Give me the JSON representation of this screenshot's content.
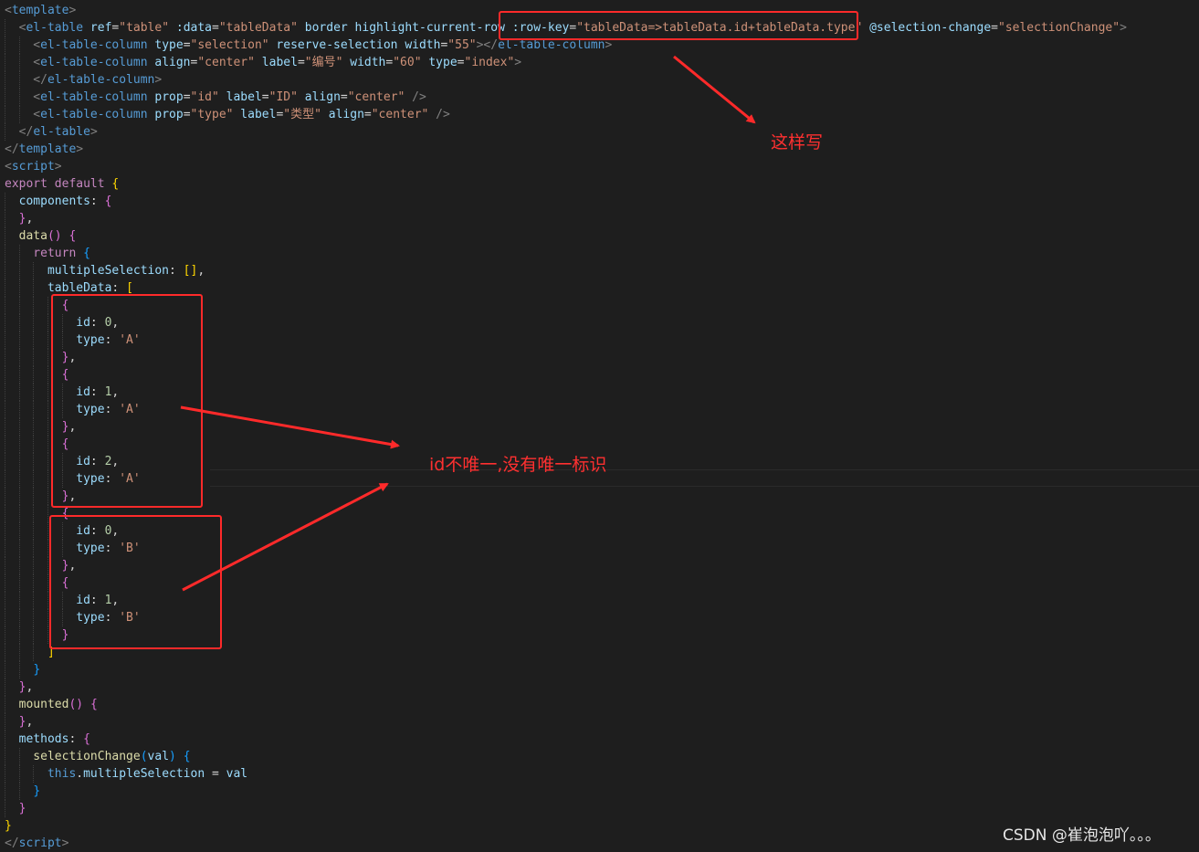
{
  "editor": {
    "lines": [
      {
        "tokens": [
          {
            "t": "<",
            "c": "t-ptag"
          },
          {
            "t": "template",
            "c": "t-tag"
          },
          {
            "t": ">",
            "c": "t-ptag"
          }
        ]
      },
      {
        "tokens": [
          {
            "t": "  <",
            "c": "t-ptag"
          },
          {
            "t": "el-table",
            "c": "t-tag"
          },
          {
            "t": " ref",
            "c": "t-attr"
          },
          {
            "t": "=",
            "c": "t-punc"
          },
          {
            "t": "\"table\"",
            "c": "t-str"
          },
          {
            "t": " :data",
            "c": "t-attr"
          },
          {
            "t": "=",
            "c": "t-punc"
          },
          {
            "t": "\"tableData\"",
            "c": "t-str"
          },
          {
            "t": " border",
            "c": "t-attr"
          },
          {
            "t": " highlight-current-row",
            "c": "t-attr"
          },
          {
            "t": " :row-key",
            "c": "t-attr"
          },
          {
            "t": "=",
            "c": "t-punc"
          },
          {
            "t": "\"tableData=>tableData.id+tableData.type\"",
            "c": "t-str"
          },
          {
            "t": " @selection-change",
            "c": "t-attr"
          },
          {
            "t": "=",
            "c": "t-punc"
          },
          {
            "t": "\"selectionChange\"",
            "c": "t-str"
          },
          {
            "t": ">",
            "c": "t-ptag"
          }
        ]
      },
      {
        "tokens": [
          {
            "t": "    <",
            "c": "t-ptag"
          },
          {
            "t": "el-table-column",
            "c": "t-tag"
          },
          {
            "t": " type",
            "c": "t-attr"
          },
          {
            "t": "=",
            "c": "t-punc"
          },
          {
            "t": "\"selection\"",
            "c": "t-str"
          },
          {
            "t": " reserve-selection",
            "c": "t-attr"
          },
          {
            "t": " width",
            "c": "t-attr"
          },
          {
            "t": "=",
            "c": "t-punc"
          },
          {
            "t": "\"55\"",
            "c": "t-str"
          },
          {
            "t": "></",
            "c": "t-ptag"
          },
          {
            "t": "el-table-column",
            "c": "t-tag"
          },
          {
            "t": ">",
            "c": "t-ptag"
          }
        ]
      },
      {
        "tokens": [
          {
            "t": "    <",
            "c": "t-ptag"
          },
          {
            "t": "el-table-column",
            "c": "t-tag"
          },
          {
            "t": " align",
            "c": "t-attr"
          },
          {
            "t": "=",
            "c": "t-punc"
          },
          {
            "t": "\"center\"",
            "c": "t-str"
          },
          {
            "t": " label",
            "c": "t-attr"
          },
          {
            "t": "=",
            "c": "t-punc"
          },
          {
            "t": "\"编号\"",
            "c": "t-str"
          },
          {
            "t": " width",
            "c": "t-attr"
          },
          {
            "t": "=",
            "c": "t-punc"
          },
          {
            "t": "\"60\"",
            "c": "t-str"
          },
          {
            "t": " type",
            "c": "t-attr"
          },
          {
            "t": "=",
            "c": "t-punc"
          },
          {
            "t": "\"index\"",
            "c": "t-str"
          },
          {
            "t": ">",
            "c": "t-ptag"
          }
        ]
      },
      {
        "tokens": [
          {
            "t": "    </",
            "c": "t-ptag"
          },
          {
            "t": "el-table-column",
            "c": "t-tag"
          },
          {
            "t": ">",
            "c": "t-ptag"
          }
        ]
      },
      {
        "tokens": [
          {
            "t": "    <",
            "c": "t-ptag"
          },
          {
            "t": "el-table-column",
            "c": "t-tag"
          },
          {
            "t": " prop",
            "c": "t-attr"
          },
          {
            "t": "=",
            "c": "t-punc"
          },
          {
            "t": "\"id\"",
            "c": "t-str"
          },
          {
            "t": " label",
            "c": "t-attr"
          },
          {
            "t": "=",
            "c": "t-punc"
          },
          {
            "t": "\"ID\"",
            "c": "t-str"
          },
          {
            "t": " align",
            "c": "t-attr"
          },
          {
            "t": "=",
            "c": "t-punc"
          },
          {
            "t": "\"center\"",
            "c": "t-str"
          },
          {
            "t": " />",
            "c": "t-ptag"
          }
        ]
      },
      {
        "tokens": [
          {
            "t": "    <",
            "c": "t-ptag"
          },
          {
            "t": "el-table-column",
            "c": "t-tag"
          },
          {
            "t": " prop",
            "c": "t-attr"
          },
          {
            "t": "=",
            "c": "t-punc"
          },
          {
            "t": "\"type\"",
            "c": "t-str"
          },
          {
            "t": " label",
            "c": "t-attr"
          },
          {
            "t": "=",
            "c": "t-punc"
          },
          {
            "t": "\"类型\"",
            "c": "t-str"
          },
          {
            "t": " align",
            "c": "t-attr"
          },
          {
            "t": "=",
            "c": "t-punc"
          },
          {
            "t": "\"center\"",
            "c": "t-str"
          },
          {
            "t": " />",
            "c": "t-ptag"
          }
        ]
      },
      {
        "tokens": [
          {
            "t": "  </",
            "c": "t-ptag"
          },
          {
            "t": "el-table",
            "c": "t-tag"
          },
          {
            "t": ">",
            "c": "t-ptag"
          }
        ]
      },
      {
        "tokens": [
          {
            "t": "</",
            "c": "t-ptag"
          },
          {
            "t": "template",
            "c": "t-tag"
          },
          {
            "t": ">",
            "c": "t-ptag"
          }
        ]
      },
      {
        "tokens": [
          {
            "t": "<",
            "c": "t-ptag"
          },
          {
            "t": "script",
            "c": "t-tag"
          },
          {
            "t": ">",
            "c": "t-ptag"
          }
        ]
      },
      {
        "tokens": [
          {
            "t": "export",
            "c": "t-kw"
          },
          {
            "t": " default ",
            "c": "t-kw"
          },
          {
            "t": "{",
            "c": "t-b1"
          }
        ]
      },
      {
        "tokens": [
          {
            "t": "  components",
            "c": "t-prop"
          },
          {
            "t": ": ",
            "c": "t-punc"
          },
          {
            "t": "{",
            "c": "t-b2"
          }
        ]
      },
      {
        "tokens": [
          {
            "t": "  ",
            "c": "t-def"
          },
          {
            "t": "}",
            "c": "t-b2"
          },
          {
            "t": ",",
            "c": "t-punc"
          }
        ]
      },
      {
        "tokens": [
          {
            "t": "  data",
            "c": "t-func"
          },
          {
            "t": "()",
            "c": "t-b2"
          },
          {
            "t": " ",
            "c": "t-def"
          },
          {
            "t": "{",
            "c": "t-b2"
          }
        ]
      },
      {
        "tokens": [
          {
            "t": "    return",
            "c": "t-kw"
          },
          {
            "t": " ",
            "c": "t-def"
          },
          {
            "t": "{",
            "c": "t-b3"
          }
        ]
      },
      {
        "tokens": [
          {
            "t": "      multipleSelection",
            "c": "t-prop"
          },
          {
            "t": ": ",
            "c": "t-punc"
          },
          {
            "t": "[]",
            "c": "t-b1"
          },
          {
            "t": ",",
            "c": "t-punc"
          }
        ]
      },
      {
        "tokens": [
          {
            "t": "      tableData",
            "c": "t-prop"
          },
          {
            "t": ": ",
            "c": "t-punc"
          },
          {
            "t": "[",
            "c": "t-b1"
          }
        ]
      },
      {
        "tokens": [
          {
            "t": "        ",
            "c": "t-def"
          },
          {
            "t": "{",
            "c": "t-b2"
          }
        ]
      },
      {
        "tokens": [
          {
            "t": "          id",
            "c": "t-prop"
          },
          {
            "t": ": ",
            "c": "t-punc"
          },
          {
            "t": "0",
            "c": "t-num"
          },
          {
            "t": ",",
            "c": "t-punc"
          }
        ]
      },
      {
        "tokens": [
          {
            "t": "          type",
            "c": "t-prop"
          },
          {
            "t": ": ",
            "c": "t-punc"
          },
          {
            "t": "'A'",
            "c": "t-str"
          }
        ]
      },
      {
        "tokens": [
          {
            "t": "        ",
            "c": "t-def"
          },
          {
            "t": "}",
            "c": "t-b2"
          },
          {
            "t": ",",
            "c": "t-punc"
          }
        ]
      },
      {
        "tokens": [
          {
            "t": "        ",
            "c": "t-def"
          },
          {
            "t": "{",
            "c": "t-b2"
          }
        ]
      },
      {
        "tokens": [
          {
            "t": "          id",
            "c": "t-prop"
          },
          {
            "t": ": ",
            "c": "t-punc"
          },
          {
            "t": "1",
            "c": "t-num"
          },
          {
            "t": ",",
            "c": "t-punc"
          }
        ]
      },
      {
        "tokens": [
          {
            "t": "          type",
            "c": "t-prop"
          },
          {
            "t": ": ",
            "c": "t-punc"
          },
          {
            "t": "'A'",
            "c": "t-str"
          }
        ]
      },
      {
        "tokens": [
          {
            "t": "        ",
            "c": "t-def"
          },
          {
            "t": "}",
            "c": "t-b2"
          },
          {
            "t": ",",
            "c": "t-punc"
          }
        ]
      },
      {
        "tokens": [
          {
            "t": "        ",
            "c": "t-def"
          },
          {
            "t": "{",
            "c": "t-b2"
          }
        ]
      },
      {
        "tokens": [
          {
            "t": "          id",
            "c": "t-prop"
          },
          {
            "t": ": ",
            "c": "t-punc"
          },
          {
            "t": "2",
            "c": "t-num"
          },
          {
            "t": ",",
            "c": "t-punc"
          }
        ]
      },
      {
        "tokens": [
          {
            "t": "          type",
            "c": "t-prop"
          },
          {
            "t": ": ",
            "c": "t-punc"
          },
          {
            "t": "'A'",
            "c": "t-str"
          }
        ]
      },
      {
        "tokens": [
          {
            "t": "        ",
            "c": "t-def"
          },
          {
            "t": "}",
            "c": "t-b2"
          },
          {
            "t": ",",
            "c": "t-punc"
          }
        ]
      },
      {
        "tokens": [
          {
            "t": "        ",
            "c": "t-def"
          },
          {
            "t": "{",
            "c": "t-b2"
          }
        ]
      },
      {
        "tokens": [
          {
            "t": "          id",
            "c": "t-prop"
          },
          {
            "t": ": ",
            "c": "t-punc"
          },
          {
            "t": "0",
            "c": "t-num"
          },
          {
            "t": ",",
            "c": "t-punc"
          }
        ]
      },
      {
        "tokens": [
          {
            "t": "          type",
            "c": "t-prop"
          },
          {
            "t": ": ",
            "c": "t-punc"
          },
          {
            "t": "'B'",
            "c": "t-str"
          }
        ]
      },
      {
        "tokens": [
          {
            "t": "        ",
            "c": "t-def"
          },
          {
            "t": "}",
            "c": "t-b2"
          },
          {
            "t": ",",
            "c": "t-punc"
          }
        ]
      },
      {
        "tokens": [
          {
            "t": "        ",
            "c": "t-def"
          },
          {
            "t": "{",
            "c": "t-b2"
          }
        ]
      },
      {
        "tokens": [
          {
            "t": "          id",
            "c": "t-prop"
          },
          {
            "t": ": ",
            "c": "t-punc"
          },
          {
            "t": "1",
            "c": "t-num"
          },
          {
            "t": ",",
            "c": "t-punc"
          }
        ]
      },
      {
        "tokens": [
          {
            "t": "          type",
            "c": "t-prop"
          },
          {
            "t": ": ",
            "c": "t-punc"
          },
          {
            "t": "'B'",
            "c": "t-str"
          }
        ]
      },
      {
        "tokens": [
          {
            "t": "        ",
            "c": "t-def"
          },
          {
            "t": "}",
            "c": "t-b2"
          }
        ]
      },
      {
        "tokens": [
          {
            "t": "      ",
            "c": "t-def"
          },
          {
            "t": "]",
            "c": "t-b1"
          }
        ]
      },
      {
        "tokens": [
          {
            "t": "    ",
            "c": "t-def"
          },
          {
            "t": "}",
            "c": "t-b3"
          }
        ]
      },
      {
        "tokens": [
          {
            "t": "  ",
            "c": "t-def"
          },
          {
            "t": "}",
            "c": "t-b2"
          },
          {
            "t": ",",
            "c": "t-punc"
          }
        ]
      },
      {
        "tokens": [
          {
            "t": "  mounted",
            "c": "t-func"
          },
          {
            "t": "()",
            "c": "t-b2"
          },
          {
            "t": " ",
            "c": "t-def"
          },
          {
            "t": "{",
            "c": "t-b2"
          }
        ]
      },
      {
        "tokens": [
          {
            "t": "  ",
            "c": "t-def"
          },
          {
            "t": "}",
            "c": "t-b2"
          },
          {
            "t": ",",
            "c": "t-punc"
          }
        ]
      },
      {
        "tokens": [
          {
            "t": "  methods",
            "c": "t-prop"
          },
          {
            "t": ": ",
            "c": "t-punc"
          },
          {
            "t": "{",
            "c": "t-b2"
          }
        ]
      },
      {
        "tokens": [
          {
            "t": "    selectionChange",
            "c": "t-func"
          },
          {
            "t": "(",
            "c": "t-b3"
          },
          {
            "t": "val",
            "c": "t-prop"
          },
          {
            "t": ")",
            "c": "t-b3"
          },
          {
            "t": " ",
            "c": "t-def"
          },
          {
            "t": "{",
            "c": "t-b3"
          }
        ]
      },
      {
        "tokens": [
          {
            "t": "      this",
            "c": "t-this"
          },
          {
            "t": ".",
            "c": "t-punc"
          },
          {
            "t": "multipleSelection",
            "c": "t-prop"
          },
          {
            "t": " = ",
            "c": "t-punc"
          },
          {
            "t": "val",
            "c": "t-prop"
          }
        ]
      },
      {
        "tokens": [
          {
            "t": "    ",
            "c": "t-def"
          },
          {
            "t": "}",
            "c": "t-b3"
          }
        ]
      },
      {
        "tokens": [
          {
            "t": "  ",
            "c": "t-def"
          },
          {
            "t": "}",
            "c": "t-b2"
          }
        ]
      },
      {
        "tokens": [
          {
            "t": "}",
            "c": "t-b1"
          }
        ]
      },
      {
        "tokens": [
          {
            "t": "</",
            "c": "t-ptag"
          },
          {
            "t": "script",
            "c": "t-tag"
          },
          {
            "t": ">",
            "c": "t-ptag"
          }
        ]
      }
    ]
  },
  "annotations": {
    "note_rowkey": "这样写",
    "note_unique": "id不唯一,没有唯一标识",
    "color": "#ff2a2a"
  },
  "watermark": {
    "text": "CSDN @崔泡泡吖。。。"
  }
}
